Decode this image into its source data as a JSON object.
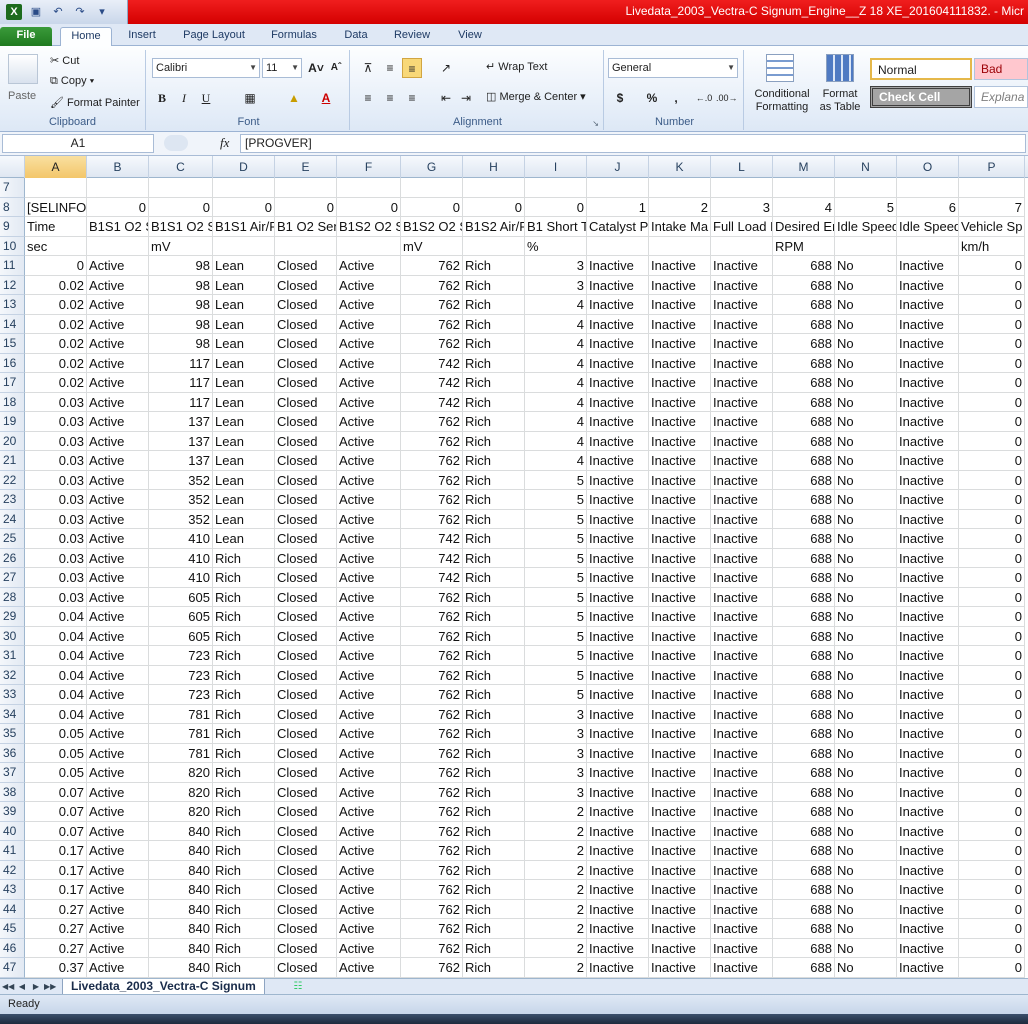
{
  "window": {
    "title": "Livedata_2003_Vectra-C  Signum_Engine__Z 18 XE_201604111832.  - Micr"
  },
  "ribbon_tabs": [
    "File",
    "Home",
    "Insert",
    "Page Layout",
    "Formulas",
    "Data",
    "Review",
    "View"
  ],
  "clipboard": {
    "paste": "Paste",
    "cut": "Cut",
    "copy": "Copy",
    "format_painter": "Format Painter",
    "label": "Clipboard"
  },
  "font": {
    "name": "Calibri",
    "size": "11",
    "label": "Font",
    "bold": "B",
    "italic": "I",
    "underline": "U"
  },
  "alignment": {
    "wrap_text": "Wrap Text",
    "merge_center": "Merge & Center",
    "label": "Alignment"
  },
  "number": {
    "format": "General",
    "label": "Number"
  },
  "styles": {
    "conditional": "Conditional Formatting",
    "format_table": "Format as Table",
    "normal": "Normal",
    "bad": "Bad",
    "check_cell": "Check Cell",
    "explanatory": "Explana"
  },
  "formula_bar": {
    "namebox": "A1",
    "fx": "fx",
    "formula": "[PROGVER]"
  },
  "columns": [
    "A",
    "B",
    "C",
    "D",
    "E",
    "F",
    "G",
    "H",
    "I",
    "J",
    "K",
    "L",
    "M",
    "N",
    "O",
    "P"
  ],
  "grid_rows": [
    {
      "n": "7",
      "c": [
        "",
        "",
        "",
        "",
        "",
        "",
        "",
        "",
        "",
        "",
        "",
        "",
        "",
        "",
        "",
        ""
      ]
    },
    {
      "n": "8",
      "c": [
        "[SELINFO]",
        "0",
        "0",
        "0",
        "0",
        "0",
        "0",
        "0",
        "0",
        "1",
        "2",
        "3",
        "4",
        "5",
        "6",
        "7"
      ]
    },
    {
      "n": "9",
      "c": [
        "Time",
        "B1S1 O2 Se",
        "B1S1 O2 Se",
        "B1S1 Air/F",
        "B1 O2 Sen",
        "B1S2 O2 Se",
        "B1S2 O2 Se",
        "B1S2 Air/F",
        "B1 Short T",
        "Catalyst P",
        "Intake Ma",
        "Full Load E",
        "Desired En",
        "Idle Speed",
        "Idle Speed",
        "Vehicle Sp"
      ]
    },
    {
      "n": "10",
      "c": [
        "sec",
        "",
        "mV",
        "",
        "",
        "",
        "mV",
        "",
        "%",
        "",
        "",
        "",
        "RPM",
        "",
        "",
        "km/h"
      ]
    },
    {
      "n": "11",
      "c": [
        "0",
        "Active",
        "98",
        "Lean",
        "Closed",
        "Active",
        "762",
        "Rich",
        "3",
        "Inactive",
        "Inactive",
        "Inactive",
        "688",
        "No",
        "Inactive",
        "0"
      ]
    },
    {
      "n": "12",
      "c": [
        "0.02",
        "Active",
        "98",
        "Lean",
        "Closed",
        "Active",
        "762",
        "Rich",
        "3",
        "Inactive",
        "Inactive",
        "Inactive",
        "688",
        "No",
        "Inactive",
        "0"
      ]
    },
    {
      "n": "13",
      "c": [
        "0.02",
        "Active",
        "98",
        "Lean",
        "Closed",
        "Active",
        "762",
        "Rich",
        "4",
        "Inactive",
        "Inactive",
        "Inactive",
        "688",
        "No",
        "Inactive",
        "0"
      ]
    },
    {
      "n": "14",
      "c": [
        "0.02",
        "Active",
        "98",
        "Lean",
        "Closed",
        "Active",
        "762",
        "Rich",
        "4",
        "Inactive",
        "Inactive",
        "Inactive",
        "688",
        "No",
        "Inactive",
        "0"
      ]
    },
    {
      "n": "15",
      "c": [
        "0.02",
        "Active",
        "98",
        "Lean",
        "Closed",
        "Active",
        "762",
        "Rich",
        "4",
        "Inactive",
        "Inactive",
        "Inactive",
        "688",
        "No",
        "Inactive",
        "0"
      ]
    },
    {
      "n": "16",
      "c": [
        "0.02",
        "Active",
        "117",
        "Lean",
        "Closed",
        "Active",
        "742",
        "Rich",
        "4",
        "Inactive",
        "Inactive",
        "Inactive",
        "688",
        "No",
        "Inactive",
        "0"
      ]
    },
    {
      "n": "17",
      "c": [
        "0.02",
        "Active",
        "117",
        "Lean",
        "Closed",
        "Active",
        "742",
        "Rich",
        "4",
        "Inactive",
        "Inactive",
        "Inactive",
        "688",
        "No",
        "Inactive",
        "0"
      ]
    },
    {
      "n": "18",
      "c": [
        "0.03",
        "Active",
        "117",
        "Lean",
        "Closed",
        "Active",
        "742",
        "Rich",
        "4",
        "Inactive",
        "Inactive",
        "Inactive",
        "688",
        "No",
        "Inactive",
        "0"
      ]
    },
    {
      "n": "19",
      "c": [
        "0.03",
        "Active",
        "137",
        "Lean",
        "Closed",
        "Active",
        "762",
        "Rich",
        "4",
        "Inactive",
        "Inactive",
        "Inactive",
        "688",
        "No",
        "Inactive",
        "0"
      ]
    },
    {
      "n": "20",
      "c": [
        "0.03",
        "Active",
        "137",
        "Lean",
        "Closed",
        "Active",
        "762",
        "Rich",
        "4",
        "Inactive",
        "Inactive",
        "Inactive",
        "688",
        "No",
        "Inactive",
        "0"
      ]
    },
    {
      "n": "21",
      "c": [
        "0.03",
        "Active",
        "137",
        "Lean",
        "Closed",
        "Active",
        "762",
        "Rich",
        "4",
        "Inactive",
        "Inactive",
        "Inactive",
        "688",
        "No",
        "Inactive",
        "0"
      ]
    },
    {
      "n": "22",
      "c": [
        "0.03",
        "Active",
        "352",
        "Lean",
        "Closed",
        "Active",
        "762",
        "Rich",
        "5",
        "Inactive",
        "Inactive",
        "Inactive",
        "688",
        "No",
        "Inactive",
        "0"
      ]
    },
    {
      "n": "23",
      "c": [
        "0.03",
        "Active",
        "352",
        "Lean",
        "Closed",
        "Active",
        "762",
        "Rich",
        "5",
        "Inactive",
        "Inactive",
        "Inactive",
        "688",
        "No",
        "Inactive",
        "0"
      ]
    },
    {
      "n": "24",
      "c": [
        "0.03",
        "Active",
        "352",
        "Lean",
        "Closed",
        "Active",
        "762",
        "Rich",
        "5",
        "Inactive",
        "Inactive",
        "Inactive",
        "688",
        "No",
        "Inactive",
        "0"
      ]
    },
    {
      "n": "25",
      "c": [
        "0.03",
        "Active",
        "410",
        "Lean",
        "Closed",
        "Active",
        "742",
        "Rich",
        "5",
        "Inactive",
        "Inactive",
        "Inactive",
        "688",
        "No",
        "Inactive",
        "0"
      ]
    },
    {
      "n": "26",
      "c": [
        "0.03",
        "Active",
        "410",
        "Rich",
        "Closed",
        "Active",
        "742",
        "Rich",
        "5",
        "Inactive",
        "Inactive",
        "Inactive",
        "688",
        "No",
        "Inactive",
        "0"
      ]
    },
    {
      "n": "27",
      "c": [
        "0.03",
        "Active",
        "410",
        "Rich",
        "Closed",
        "Active",
        "742",
        "Rich",
        "5",
        "Inactive",
        "Inactive",
        "Inactive",
        "688",
        "No",
        "Inactive",
        "0"
      ]
    },
    {
      "n": "28",
      "c": [
        "0.03",
        "Active",
        "605",
        "Rich",
        "Closed",
        "Active",
        "762",
        "Rich",
        "5",
        "Inactive",
        "Inactive",
        "Inactive",
        "688",
        "No",
        "Inactive",
        "0"
      ]
    },
    {
      "n": "29",
      "c": [
        "0.04",
        "Active",
        "605",
        "Rich",
        "Closed",
        "Active",
        "762",
        "Rich",
        "5",
        "Inactive",
        "Inactive",
        "Inactive",
        "688",
        "No",
        "Inactive",
        "0"
      ]
    },
    {
      "n": "30",
      "c": [
        "0.04",
        "Active",
        "605",
        "Rich",
        "Closed",
        "Active",
        "762",
        "Rich",
        "5",
        "Inactive",
        "Inactive",
        "Inactive",
        "688",
        "No",
        "Inactive",
        "0"
      ]
    },
    {
      "n": "31",
      "c": [
        "0.04",
        "Active",
        "723",
        "Rich",
        "Closed",
        "Active",
        "762",
        "Rich",
        "5",
        "Inactive",
        "Inactive",
        "Inactive",
        "688",
        "No",
        "Inactive",
        "0"
      ]
    },
    {
      "n": "32",
      "c": [
        "0.04",
        "Active",
        "723",
        "Rich",
        "Closed",
        "Active",
        "762",
        "Rich",
        "5",
        "Inactive",
        "Inactive",
        "Inactive",
        "688",
        "No",
        "Inactive",
        "0"
      ]
    },
    {
      "n": "33",
      "c": [
        "0.04",
        "Active",
        "723",
        "Rich",
        "Closed",
        "Active",
        "762",
        "Rich",
        "5",
        "Inactive",
        "Inactive",
        "Inactive",
        "688",
        "No",
        "Inactive",
        "0"
      ]
    },
    {
      "n": "34",
      "c": [
        "0.04",
        "Active",
        "781",
        "Rich",
        "Closed",
        "Active",
        "762",
        "Rich",
        "3",
        "Inactive",
        "Inactive",
        "Inactive",
        "688",
        "No",
        "Inactive",
        "0"
      ]
    },
    {
      "n": "35",
      "c": [
        "0.05",
        "Active",
        "781",
        "Rich",
        "Closed",
        "Active",
        "762",
        "Rich",
        "3",
        "Inactive",
        "Inactive",
        "Inactive",
        "688",
        "No",
        "Inactive",
        "0"
      ]
    },
    {
      "n": "36",
      "c": [
        "0.05",
        "Active",
        "781",
        "Rich",
        "Closed",
        "Active",
        "762",
        "Rich",
        "3",
        "Inactive",
        "Inactive",
        "Inactive",
        "688",
        "No",
        "Inactive",
        "0"
      ]
    },
    {
      "n": "37",
      "c": [
        "0.05",
        "Active",
        "820",
        "Rich",
        "Closed",
        "Active",
        "762",
        "Rich",
        "3",
        "Inactive",
        "Inactive",
        "Inactive",
        "688",
        "No",
        "Inactive",
        "0"
      ]
    },
    {
      "n": "38",
      "c": [
        "0.07",
        "Active",
        "820",
        "Rich",
        "Closed",
        "Active",
        "762",
        "Rich",
        "3",
        "Inactive",
        "Inactive",
        "Inactive",
        "688",
        "No",
        "Inactive",
        "0"
      ]
    },
    {
      "n": "39",
      "c": [
        "0.07",
        "Active",
        "820",
        "Rich",
        "Closed",
        "Active",
        "762",
        "Rich",
        "2",
        "Inactive",
        "Inactive",
        "Inactive",
        "688",
        "No",
        "Inactive",
        "0"
      ]
    },
    {
      "n": "40",
      "c": [
        "0.07",
        "Active",
        "840",
        "Rich",
        "Closed",
        "Active",
        "762",
        "Rich",
        "2",
        "Inactive",
        "Inactive",
        "Inactive",
        "688",
        "No",
        "Inactive",
        "0"
      ]
    },
    {
      "n": "41",
      "c": [
        "0.17",
        "Active",
        "840",
        "Rich",
        "Closed",
        "Active",
        "762",
        "Rich",
        "2",
        "Inactive",
        "Inactive",
        "Inactive",
        "688",
        "No",
        "Inactive",
        "0"
      ]
    },
    {
      "n": "42",
      "c": [
        "0.17",
        "Active",
        "840",
        "Rich",
        "Closed",
        "Active",
        "762",
        "Rich",
        "2",
        "Inactive",
        "Inactive",
        "Inactive",
        "688",
        "No",
        "Inactive",
        "0"
      ]
    },
    {
      "n": "43",
      "c": [
        "0.17",
        "Active",
        "840",
        "Rich",
        "Closed",
        "Active",
        "762",
        "Rich",
        "2",
        "Inactive",
        "Inactive",
        "Inactive",
        "688",
        "No",
        "Inactive",
        "0"
      ]
    },
    {
      "n": "44",
      "c": [
        "0.27",
        "Active",
        "840",
        "Rich",
        "Closed",
        "Active",
        "762",
        "Rich",
        "2",
        "Inactive",
        "Inactive",
        "Inactive",
        "688",
        "No",
        "Inactive",
        "0"
      ]
    },
    {
      "n": "45",
      "c": [
        "0.27",
        "Active",
        "840",
        "Rich",
        "Closed",
        "Active",
        "762",
        "Rich",
        "2",
        "Inactive",
        "Inactive",
        "Inactive",
        "688",
        "No",
        "Inactive",
        "0"
      ]
    },
    {
      "n": "46",
      "c": [
        "0.27",
        "Active",
        "840",
        "Rich",
        "Closed",
        "Active",
        "762",
        "Rich",
        "2",
        "Inactive",
        "Inactive",
        "Inactive",
        "688",
        "No",
        "Inactive",
        "0"
      ]
    },
    {
      "n": "47",
      "c": [
        "0.37",
        "Active",
        "840",
        "Rich",
        "Closed",
        "Active",
        "762",
        "Rich",
        "2",
        "Inactive",
        "Inactive",
        "Inactive",
        "688",
        "No",
        "Inactive",
        "0"
      ]
    }
  ],
  "sheet_tab": "Livedata_2003_Vectra-C  Signum",
  "status": "Ready",
  "colors": {
    "title_red": "#e00000",
    "ribbon_blue": "#dfe8f5",
    "file_green": "#2a8a2a",
    "selected_header": "#f3c66a"
  }
}
